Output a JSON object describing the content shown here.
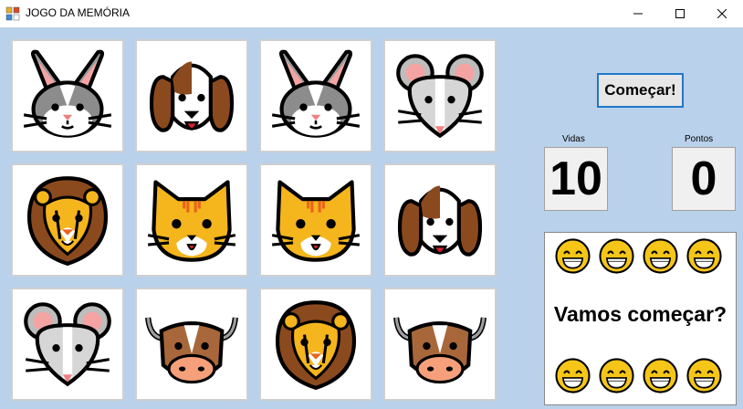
{
  "window": {
    "title": "JOGO DA MEMÓRIA",
    "controls": [
      "minimize",
      "maximize",
      "close"
    ]
  },
  "board": {
    "cards": [
      {
        "animal": "rabbit"
      },
      {
        "animal": "dog"
      },
      {
        "animal": "rabbit"
      },
      {
        "animal": "mouse"
      },
      {
        "animal": "lion"
      },
      {
        "animal": "cat"
      },
      {
        "animal": "cat"
      },
      {
        "animal": "dog"
      },
      {
        "animal": "mouse"
      },
      {
        "animal": "cow"
      },
      {
        "animal": "lion"
      },
      {
        "animal": "cow"
      }
    ]
  },
  "controls": {
    "start_label": "Começar!"
  },
  "stats": {
    "lives_label": "Vidas",
    "lives_value": "10",
    "points_label": "Pontos",
    "points_value": "0"
  },
  "message": {
    "text": "Vamos começar?",
    "smiley_icon": "grinning-face-icon"
  },
  "colors": {
    "client_bg": "#b9d1ea",
    "button_border": "#1f78c8"
  }
}
